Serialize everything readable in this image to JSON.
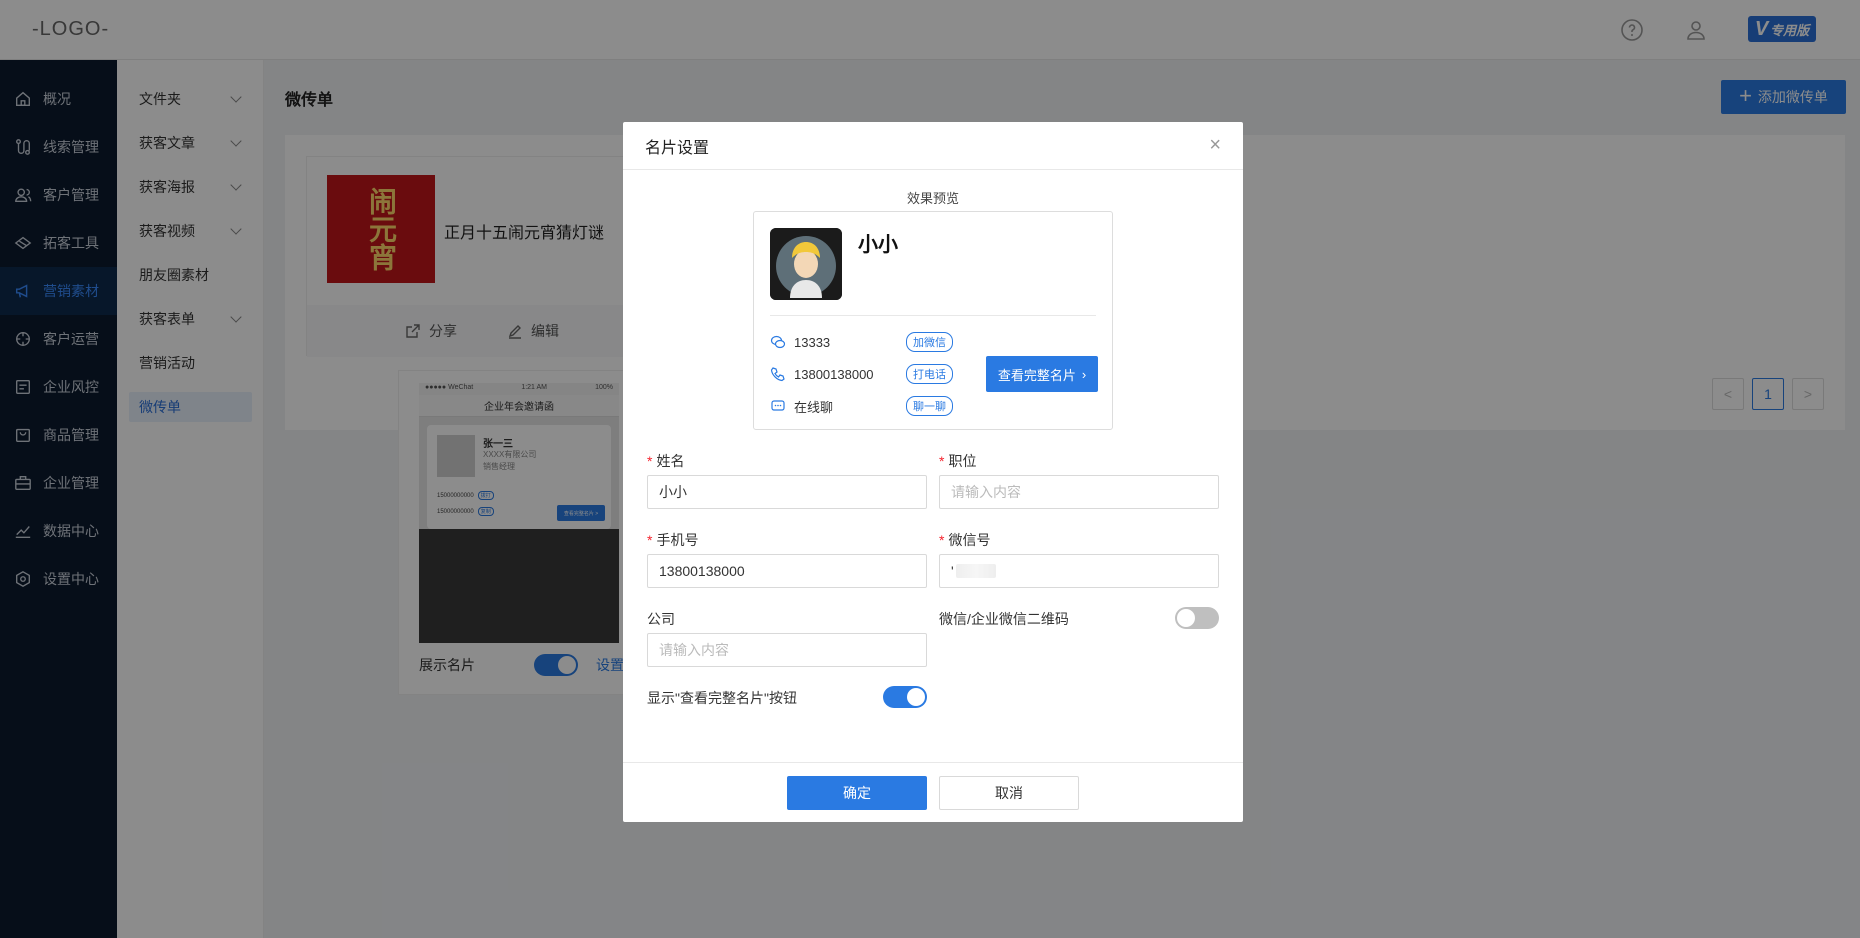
{
  "header": {
    "logo": "-LOGO-",
    "vip_badge": "专用版",
    "vip_letter": "V",
    "icons": [
      "help-icon",
      "user-icon"
    ]
  },
  "sidebar": {
    "items": [
      {
        "label": "概况",
        "icon": "home-icon"
      },
      {
        "label": "线索管理",
        "icon": "route-icon"
      },
      {
        "label": "客户管理",
        "icon": "users-icon"
      },
      {
        "label": "拓客工具",
        "icon": "tool-icon"
      },
      {
        "label": "营销素材",
        "icon": "megaphone-icon",
        "active": true
      },
      {
        "label": "客户运营",
        "icon": "operation-icon"
      },
      {
        "label": "企业风控",
        "icon": "risk-icon"
      },
      {
        "label": "商品管理",
        "icon": "bag-icon"
      },
      {
        "label": "企业管理",
        "icon": "briefcase-icon"
      },
      {
        "label": "数据中心",
        "icon": "chart-icon"
      },
      {
        "label": "设置中心",
        "icon": "settings-icon"
      }
    ]
  },
  "subnav": {
    "items": [
      {
        "label": "文件夹",
        "expandable": true
      },
      {
        "label": "获客文章",
        "expandable": true
      },
      {
        "label": "获客海报",
        "expandable": true
      },
      {
        "label": "获客视频",
        "expandable": true
      },
      {
        "label": "朋友圈素材",
        "expandable": false
      },
      {
        "label": "获客表单",
        "expandable": true
      },
      {
        "label": "营销活动",
        "expandable": false
      },
      {
        "label": "微传单",
        "expandable": false,
        "active": true
      }
    ]
  },
  "main": {
    "title": "微传单",
    "add_button": "添加微传单",
    "card": {
      "thumb_text": "闹元宵",
      "title": "正月十五闹元宵猜灯谜",
      "share": "分享",
      "edit": "编辑"
    },
    "phone_preview": {
      "status_left": "●●●●● WeChat",
      "status_mid": "1:21 AM",
      "status_right": "100%",
      "header": "企业年会邀请函",
      "name": "张一三",
      "company": "XXXX有限公司",
      "position": "销售经理",
      "phone1": "15000000000",
      "phone2": "15000000000",
      "tag1": "拨打",
      "tag2": "复制",
      "button": "查看完整名片 >"
    },
    "show_card_label": "展示名片",
    "show_card_on": true,
    "settings_link": "设置",
    "pagination": {
      "prev": "<",
      "current": "1",
      "next": ">"
    }
  },
  "modal": {
    "title": "名片设置",
    "close": "×",
    "preview_label": "效果预览",
    "preview": {
      "name": "小小",
      "wechat": "13333",
      "wechat_tag": "加微信",
      "phone": "13800138000",
      "phone_tag": "打电话",
      "chat": "在线聊",
      "chat_tag": "聊一聊",
      "full_card_button": "查看完整名片"
    },
    "fields": {
      "name_label": "姓名",
      "name_value": "小小",
      "position_label": "职位",
      "position_placeholder": "请输入内容",
      "phone_label": "手机号",
      "phone_value": "13800138000",
      "wechat_label": "微信号",
      "wechat_value": "'",
      "company_label": "公司",
      "company_placeholder": "请输入内容",
      "qr_label": "微信/企业微信二维码",
      "qr_on": false,
      "show_btn_label": "显示\"查看完整名片\"按钮",
      "show_btn_on": true
    },
    "ok": "确定",
    "cancel": "取消"
  }
}
